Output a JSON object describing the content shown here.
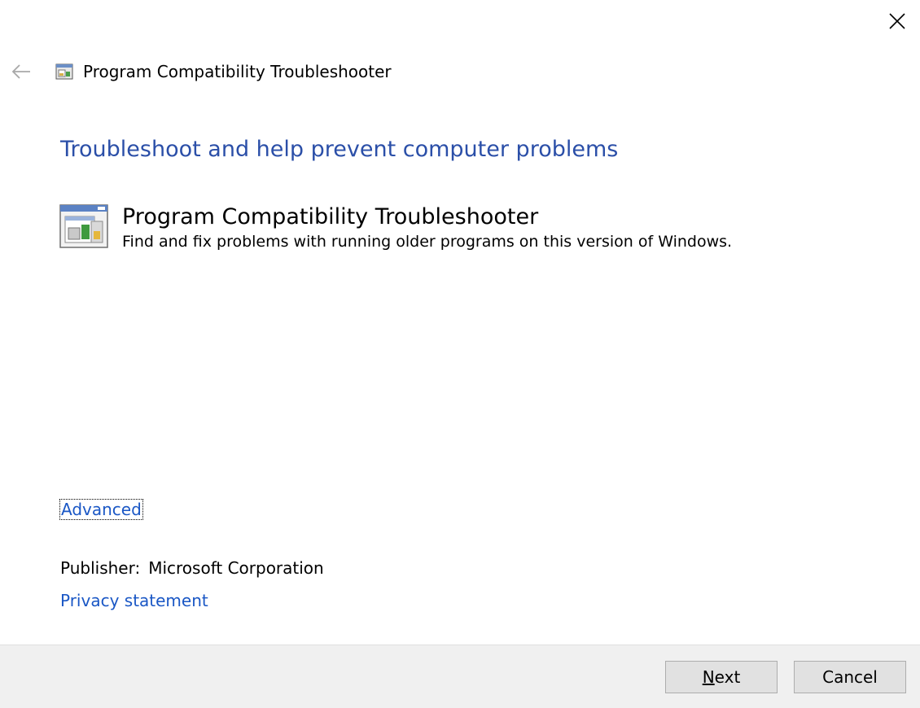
{
  "window": {
    "title": "Program Compatibility Troubleshooter"
  },
  "icons": {
    "close": "close-icon",
    "back": "back-arrow-icon",
    "app": "troubleshooter-icon"
  },
  "main": {
    "heading": "Troubleshoot and help prevent computer problems",
    "tool": {
      "title": "Program Compatibility Troubleshooter",
      "description": "Find and fix problems with running older programs on this version of Windows."
    },
    "advanced_link": "Advanced",
    "publisher_label": "Publisher:",
    "publisher_value": "Microsoft Corporation",
    "privacy_link": "Privacy statement"
  },
  "footer": {
    "next_mnemonic": "N",
    "next_rest": "ext",
    "cancel_label": "Cancel"
  },
  "colors": {
    "heading": "#2b4fa8",
    "link": "#1a57c5",
    "footer_bg": "#f0f0f0"
  }
}
